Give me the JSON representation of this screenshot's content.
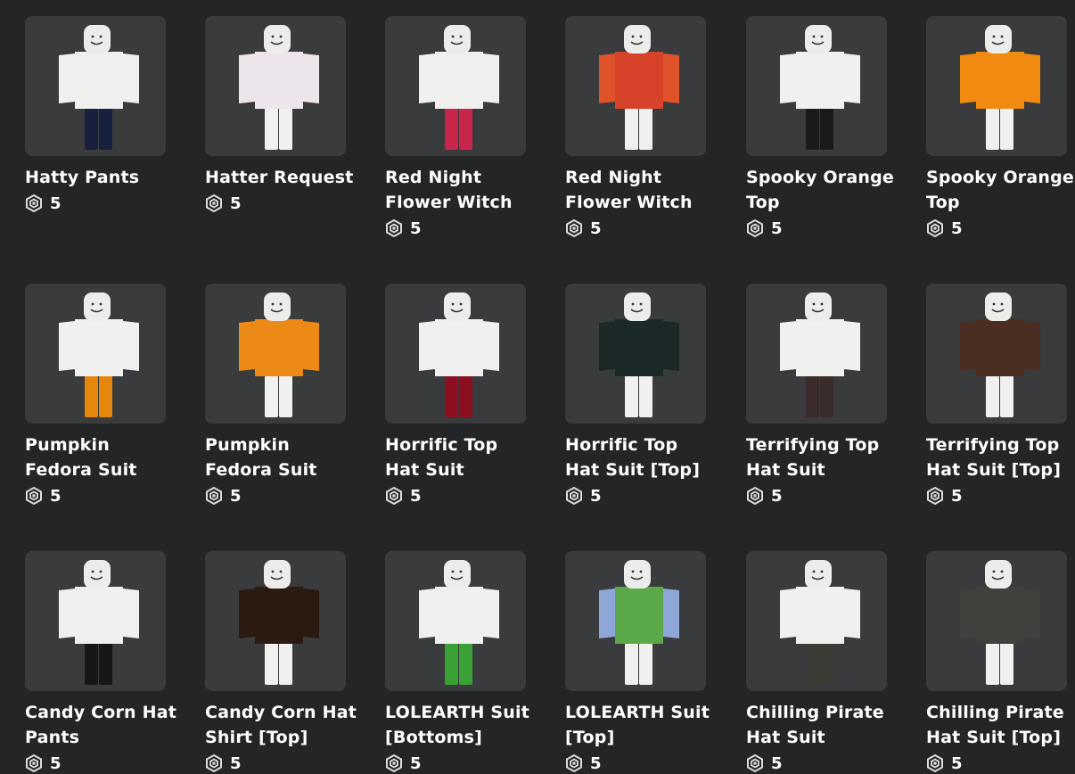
{
  "currency_icon": "robux-icon",
  "items": [
    {
      "name": "Hatty Pants",
      "price": "5",
      "torso": "#f0f0ee",
      "legs": "#17213d",
      "arms": "#f0f0ee"
    },
    {
      "name": "Hatter Request",
      "price": "5",
      "torso": "#ece6ec",
      "legs": "#f0f0ee",
      "arms": "#ece6ec"
    },
    {
      "name": "Red Night Flower Witch",
      "price": "5",
      "torso": "#f0f0ee",
      "legs": "#c8254a",
      "arms": "#f0f0ee"
    },
    {
      "name": "Red Night Flower Witch",
      "price": "5",
      "torso": "#d6422a",
      "legs": "#f0f0ee",
      "arms": "#e0532a"
    },
    {
      "name": "Spooky Orange Top",
      "price": "5",
      "torso": "#f0f0ee",
      "legs": "#1a1a1a",
      "arms": "#f0f0ee"
    },
    {
      "name": "Spooky Orange Top",
      "price": "5",
      "torso": "#f08a10",
      "legs": "#f0f0ee",
      "arms": "#f08a10"
    },
    {
      "name": "Pumpkin Fedora Suit",
      "price": "5",
      "torso": "#f0f0ee",
      "legs": "#e6870d",
      "arms": "#f0f0ee"
    },
    {
      "name": "Pumpkin Fedora Suit",
      "price": "5",
      "torso": "#ec8a18",
      "legs": "#f0f0ee",
      "arms": "#ec8a18"
    },
    {
      "name": "Horrific Top Hat Suit",
      "price": "5",
      "torso": "#f0f0ee",
      "legs": "#8e1020",
      "arms": "#f0f0ee"
    },
    {
      "name": "Horrific Top Hat Suit [Top]",
      "price": "5",
      "torso": "#1b2a28",
      "legs": "#f0f0ee",
      "arms": "#1b2a28"
    },
    {
      "name": "Terrifying Top Hat Suit",
      "price": "5",
      "torso": "#f0f0ee",
      "legs": "#3a2c2a",
      "arms": "#f0f0ee"
    },
    {
      "name": "Terrifying Top Hat Suit [Top]",
      "price": "5",
      "torso": "#4a2e22",
      "legs": "#f0f0ee",
      "arms": "#4a2e22"
    },
    {
      "name": "Candy Corn Hat Pants",
      "price": "5",
      "torso": "#f0f0ee",
      "legs": "#161616",
      "arms": "#f0f0ee"
    },
    {
      "name": "Candy Corn Hat Shirt [Top]",
      "price": "5",
      "torso": "#2a1a10",
      "legs": "#f0f0ee",
      "arms": "#2a1a10"
    },
    {
      "name": "LOLEARTH Suit [Bottoms]",
      "price": "5",
      "torso": "#f0f0ee",
      "legs": "#3aa235",
      "arms": "#f0f0ee"
    },
    {
      "name": "LOLEARTH Suit [Top]",
      "price": "5",
      "torso": "#5aa84a",
      "legs": "#f0f0ee",
      "arms": "#8fa6d8"
    },
    {
      "name": "Chilling Pirate Hat Suit",
      "price": "5",
      "torso": "#f0f0ee",
      "legs": "#3a3c36",
      "arms": "#f0f0ee"
    },
    {
      "name": "Chilling Pirate Hat Suit [Top]",
      "price": "5",
      "torso": "#3e413c",
      "legs": "#f0f0ee",
      "arms": "#3e413c"
    }
  ]
}
